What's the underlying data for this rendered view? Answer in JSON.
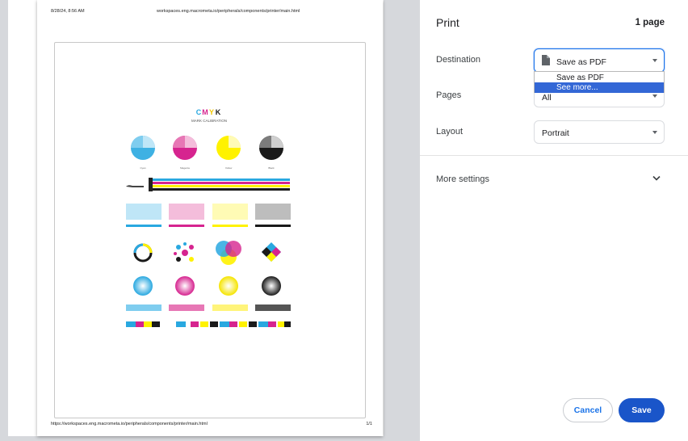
{
  "preview": {
    "header_date": "8/28/24, 8:56 AM",
    "header_url": "workspaces.eng.macrometa.io/peripherals/components/printer/main.html",
    "footer_url": "https://workspaces.eng.macrometa.io/peripherals/components/printer/main.html",
    "footer_page": "1/1",
    "figure": {
      "logo_letters": [
        "C",
        "M",
        "Y",
        "K"
      ],
      "subtitle": "MARK CALIBRATION",
      "wheel_labels": [
        "Cyan",
        "Magenta",
        "Yellow",
        "Black"
      ],
      "colors": {
        "cyan": "#29a8e0",
        "magenta": "#d6248f",
        "yellow": "#fff200",
        "black": "#1a1a1a"
      }
    }
  },
  "panel": {
    "title": "Print",
    "page_count": "1 page",
    "destination": {
      "label": "Destination",
      "value": "Save as PDF",
      "icon": "file-icon",
      "options": [
        "Save as PDF",
        "See more..."
      ],
      "highlighted": "See more..."
    },
    "pages": {
      "label": "Pages",
      "value": "All"
    },
    "layout": {
      "label": "Layout",
      "value": "Portrait"
    },
    "more_settings": {
      "label": "More settings",
      "icon": "chevron-down-icon"
    },
    "buttons": {
      "cancel": "Cancel",
      "save": "Save"
    }
  },
  "colors": {
    "accent": "#1a73e8",
    "save_button": "#1a55c9",
    "highlight": "#3367d6",
    "gutter": "#d6d8dc"
  }
}
